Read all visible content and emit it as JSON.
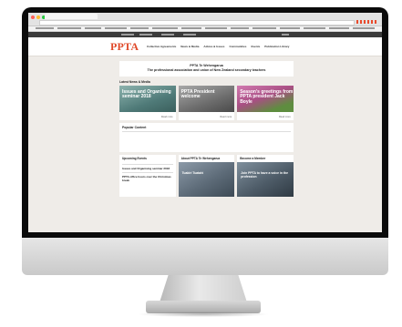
{
  "browser": {
    "tab_title": "",
    "url": "",
    "dot_colors": [
      "#ff5f57",
      "#febc2e",
      "#28c840"
    ]
  },
  "site": {
    "logo": "PPTA",
    "nav": [
      "Collective Agreements",
      "News & Media",
      "Advice & Issues",
      "Communities",
      "Events",
      "Publication Library"
    ],
    "tagline_line1": "PPTA Te Wehengarua",
    "tagline_line2": "The professional association and union of New Zealand secondary teachers",
    "accent_color": "#e04a2a"
  },
  "news": {
    "title": "Latest News & Media",
    "items": [
      {
        "headline": "Issues and Organising seminar 2018",
        "more": "Read more",
        "bg": "#7aa0a0"
      },
      {
        "headline": "PPTA President welcome",
        "more": "Read more",
        "bg": "#8f8f8f"
      },
      {
        "headline": "Season's greetings from PPTA president Jack Boyle",
        "more": "Read more",
        "bg": "#c46a9a"
      }
    ]
  },
  "popular": {
    "title": "Popular Content",
    "links": [
      "",
      "",
      "",
      "",
      "",
      ""
    ]
  },
  "bottom": {
    "events": {
      "title": "Upcoming Events",
      "item1": "Issues and Organising seminar 2018",
      "item2": "PPTA office hours over the Christmas break"
    },
    "about": {
      "title": "About PPTA Te Wehengarua",
      "caption": "Tuakiri Tuatahi"
    },
    "member": {
      "title": "Become a Member",
      "caption": "Join PPTA to have a voice in the profession"
    }
  }
}
